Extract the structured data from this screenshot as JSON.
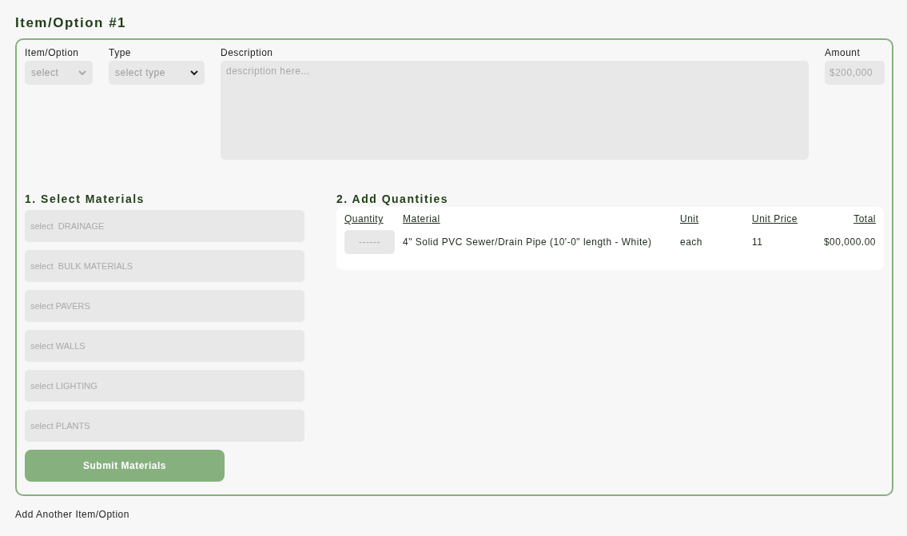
{
  "title": "Item/Option #1",
  "fields": {
    "item_option": {
      "label": "Item/Option",
      "value": "select"
    },
    "type": {
      "label": "Type",
      "value": "select type"
    },
    "description": {
      "label": "Description",
      "placeholder": "description here..."
    },
    "amount": {
      "label": "Amount",
      "placeholder": "$200,000"
    }
  },
  "materials": {
    "heading": "1. Select Materials",
    "selects": [
      "select  DRAINAGE",
      "select  BULK MATERIALS",
      "select PAVERS",
      "select WALLS",
      "select LIGHTING",
      "select PLANTS"
    ],
    "submit": "Submit Materials"
  },
  "quantities": {
    "heading": "2. Add Quantities",
    "columns": [
      "Quantity",
      "Material",
      "Unit",
      "Unit Price",
      "Total"
    ],
    "rows": [
      {
        "quantity_placeholder": "------",
        "material": "4\" Solid PVC Sewer/Drain Pipe (10'-0\" length - White)",
        "unit": "each",
        "unit_price": "11",
        "total": "$00,000.00"
      }
    ]
  },
  "add_link": "Add Another Item/Option"
}
